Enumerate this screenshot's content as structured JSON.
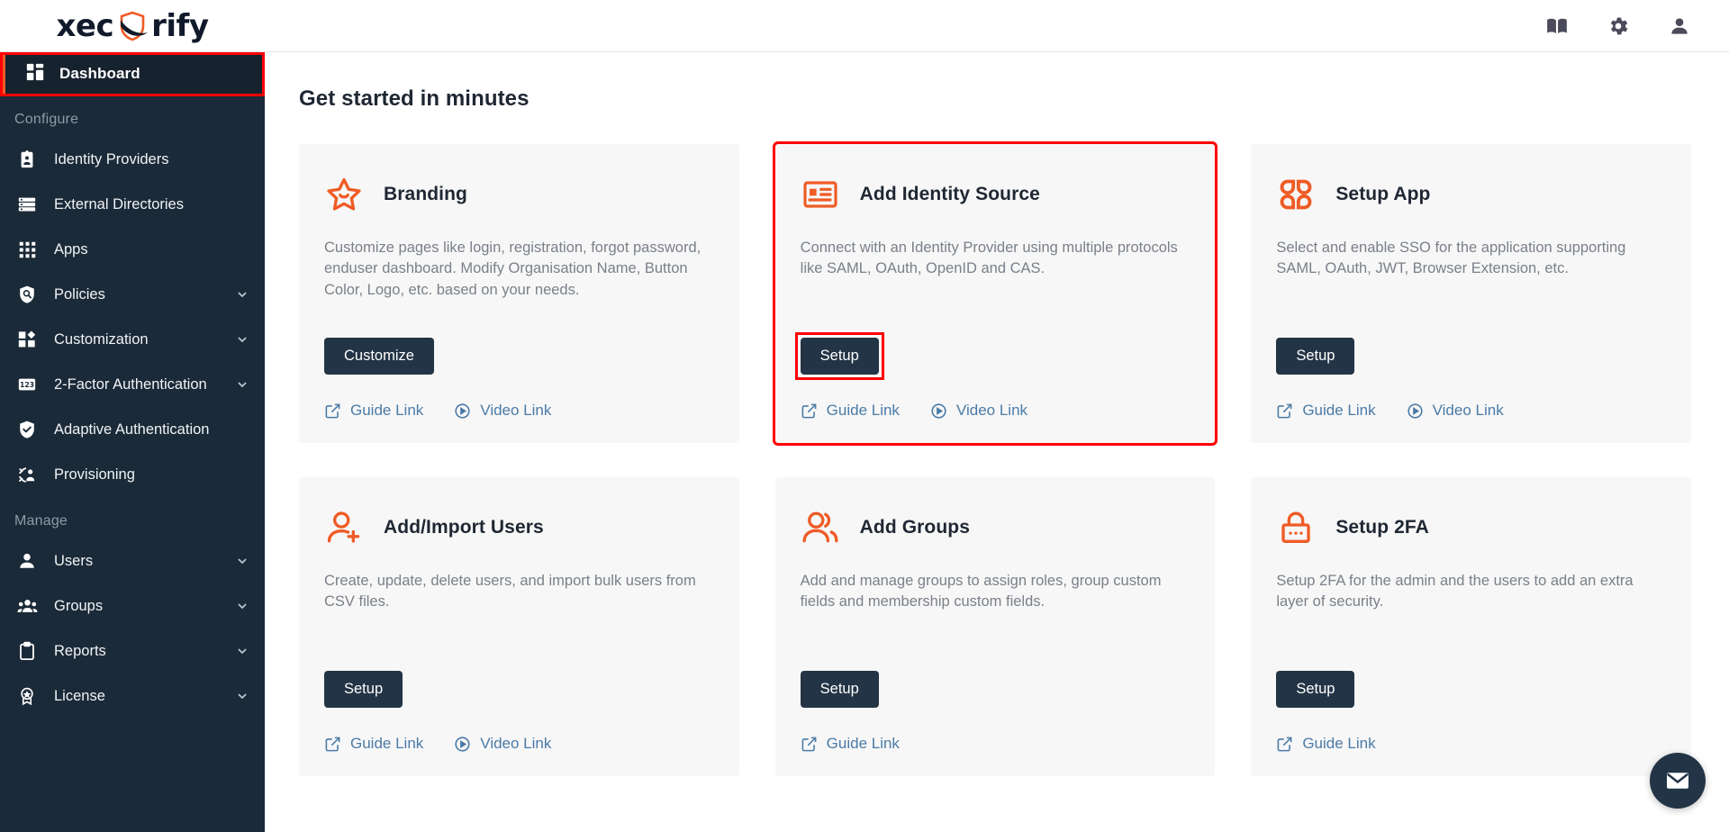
{
  "brand": {
    "text_before": "xec",
    "text_after": "rify",
    "accent_color": "#f15a29",
    "dark_color": "#111a2b"
  },
  "topbar": {
    "icons": [
      {
        "name": "book-icon",
        "label": "Documentation"
      },
      {
        "name": "gear-icon",
        "label": "Settings"
      },
      {
        "name": "person-icon",
        "label": "Account"
      }
    ]
  },
  "sidebar": {
    "active_item": {
      "label": "Dashboard",
      "icon": "dashboard-icon"
    },
    "sections": [
      {
        "title": "Configure",
        "items": [
          {
            "label": "Identity Providers",
            "icon": "id-badge-icon",
            "chevron": false
          },
          {
            "label": "External Directories",
            "icon": "directory-list-icon",
            "chevron": false
          },
          {
            "label": "Apps",
            "icon": "apps-grid-icon",
            "chevron": false
          },
          {
            "label": "Policies",
            "icon": "policy-shield-icon",
            "chevron": true
          },
          {
            "label": "Customization",
            "icon": "customization-icon",
            "chevron": true
          },
          {
            "label": "2-Factor Authentication",
            "icon": "numeric-123-icon",
            "chevron": true
          },
          {
            "label": "Adaptive Authentication",
            "icon": "shield-check-icon",
            "chevron": false
          },
          {
            "label": "Provisioning",
            "icon": "provisioning-sync-icon",
            "chevron": false
          }
        ]
      },
      {
        "title": "Manage",
        "items": [
          {
            "label": "Users",
            "icon": "user-icon",
            "chevron": true
          },
          {
            "label": "Groups",
            "icon": "group-icon",
            "chevron": true
          },
          {
            "label": "Reports",
            "icon": "clipboard-icon",
            "chevron": true
          },
          {
            "label": "License",
            "icon": "license-badge-icon",
            "chevron": true
          }
        ]
      }
    ]
  },
  "main": {
    "page_title": "Get started in minutes",
    "cards": [
      {
        "icon": "star-outline-icon",
        "title": "Branding",
        "description": "Customize pages like login, registration, forgot password, enduser dashboard. Modify Organisation Name, Button Color, Logo, etc. based on your needs.",
        "button": "Customize",
        "links": [
          {
            "label": "Guide Link",
            "icon": "external-link-icon"
          },
          {
            "label": "Video Link",
            "icon": "play-circle-icon"
          }
        ],
        "highlighted": false,
        "button_highlighted": false
      },
      {
        "icon": "identity-card-icon",
        "title": "Add Identity Source",
        "description": "Connect with an Identity Provider using multiple protocols like SAML, OAuth, OpenID and CAS.",
        "button": "Setup",
        "links": [
          {
            "label": "Guide Link",
            "icon": "external-link-icon"
          },
          {
            "label": "Video Link",
            "icon": "play-circle-icon"
          }
        ],
        "highlighted": true,
        "button_highlighted": true
      },
      {
        "icon": "four-petal-apps-icon",
        "title": "Setup App",
        "description": "Select and enable SSO for the application supporting SAML, OAuth, JWT, Browser Extension, etc.",
        "button": "Setup",
        "links": [
          {
            "label": "Guide Link",
            "icon": "external-link-icon"
          },
          {
            "label": "Video Link",
            "icon": "play-circle-icon"
          }
        ],
        "highlighted": false,
        "button_highlighted": false
      },
      {
        "icon": "user-plus-icon",
        "title": "Add/Import Users",
        "description": "Create, update, delete users, and import bulk users from CSV files.",
        "button": "Setup",
        "links": [
          {
            "label": "Guide Link",
            "icon": "external-link-icon"
          },
          {
            "label": "Video Link",
            "icon": "play-circle-icon"
          }
        ],
        "highlighted": false,
        "button_highlighted": false
      },
      {
        "icon": "two-users-icon",
        "title": "Add Groups",
        "description": "Add and manage groups to assign roles, group custom fields and membership custom fields.",
        "button": "Setup",
        "links": [
          {
            "label": "Guide Link",
            "icon": "external-link-icon"
          }
        ],
        "highlighted": false,
        "button_highlighted": false
      },
      {
        "icon": "padlock-icon",
        "title": "Setup 2FA",
        "description": "Setup 2FA for the admin and the users to add an extra layer of security.",
        "button": "Setup",
        "links": [
          {
            "label": "Guide Link",
            "icon": "external-link-icon"
          }
        ],
        "highlighted": false,
        "button_highlighted": false
      }
    ]
  },
  "chat_widget": {
    "icon": "envelope-icon",
    "label": "Open chat"
  },
  "colors": {
    "sidebar_bg": "#1b2a38",
    "accent_orange": "#ef5b25",
    "button_dark": "#233446",
    "link_blue": "#4a7ba7",
    "highlight_red": "#ff0000",
    "card_bg": "#f7f7f7"
  }
}
